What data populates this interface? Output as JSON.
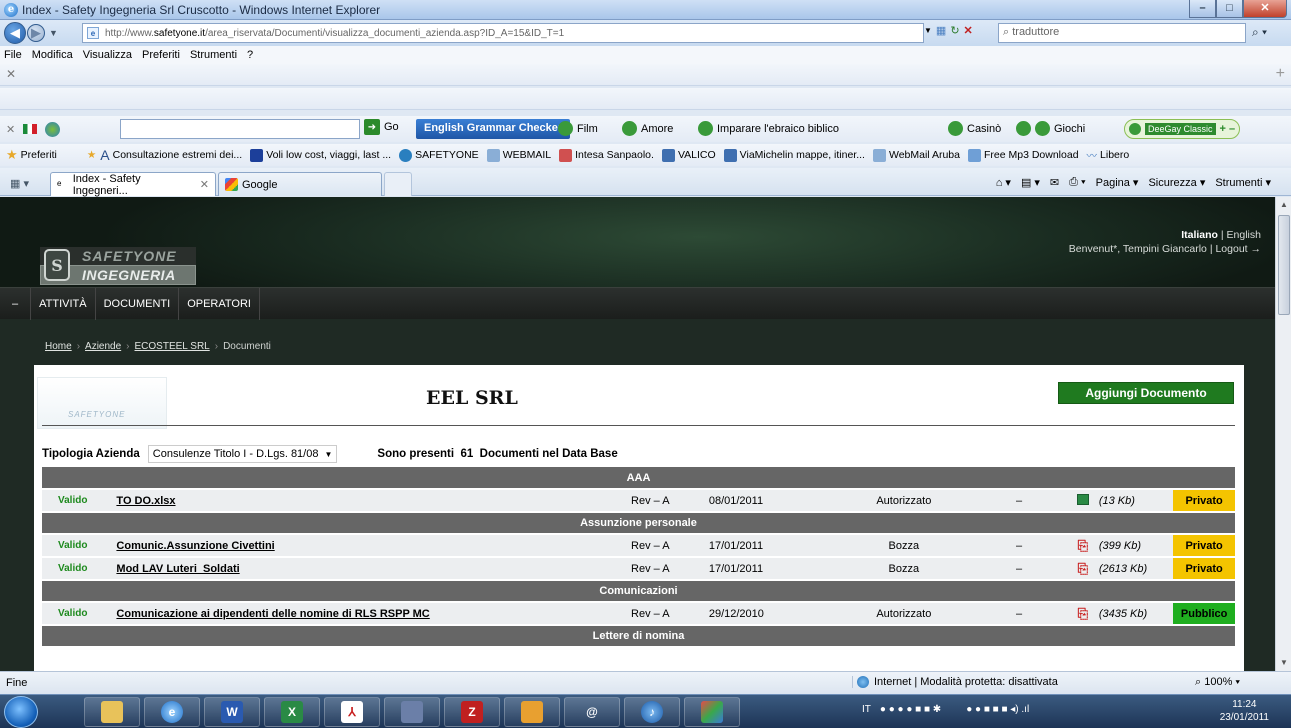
{
  "window": {
    "title": "Index - Safety Ingegneria Srl Cruscotto - Windows Internet Explorer",
    "min": "–",
    "max": "□",
    "close": "✕"
  },
  "address": {
    "url_prefix": "http://www.",
    "url_domain": "safetyone.it",
    "url_rest": "/area_riservata/Documenti/visualizza_documenti_azienda.asp?ID_A=15&ID_T=1",
    "search_placeholder": "traduttore"
  },
  "menu": [
    "File",
    "Modifica",
    "Visualizza",
    "Preferiti",
    "Strumenti",
    "?"
  ],
  "toolbar": {
    "go": "Go",
    "grammar": "English Grammar Checker",
    "film": "Film",
    "amore": "Amore",
    "ebraico": "Imparare l'ebraico biblico",
    "casino": "Casinò",
    "giochi": "Giochi",
    "deegay": "DeeGay Classic"
  },
  "favorites": {
    "label": "Preferiti",
    "items": [
      "Consultazione estremi dei...",
      "Voli low cost, viaggi, last ...",
      "SAFETYONE",
      "WEBMAIL",
      "Intesa Sanpaolo.",
      "VALICO",
      "ViaMichelin mappe, itiner...",
      "WebMail Aruba",
      "Free Mp3 Download",
      "Libero"
    ]
  },
  "tabs": [
    {
      "label": "Index - Safety Ingegneri...",
      "close": "✕"
    },
    {
      "label": "Google"
    }
  ],
  "commands": [
    "Pagina ▾",
    "Sicurezza ▾",
    "Strumenti ▾"
  ],
  "site": {
    "logo_top": "SAFETYONE",
    "logo_bottom": "INGEGNERIA",
    "lang_active": "Italiano",
    "lang_sep": " | ",
    "lang_other": "English",
    "welcome": "Benvenut*, Tempini Giancarlo | Logout →",
    "nav": [
      "–",
      "ATTIVITÀ",
      "DOCUMENTI",
      "OPERATORI"
    ],
    "breadcrumbs": [
      "Home",
      "Aziende",
      "ECOSTEEL SRL",
      "Documenti"
    ]
  },
  "content": {
    "company_logo_text": "SAFETYONE",
    "company": "EEL SRL",
    "add_button": "Aggiungi Documento",
    "type_label": "Tipologia Azienda",
    "type_value": "Consulenze Titolo I - D.Lgs. 81/08",
    "count_prefix": "Sono presenti",
    "count": "61",
    "count_suffix": "Documenti nel Data Base",
    "groups": [
      {
        "name": "AAA",
        "docs": [
          {
            "status": "Valido",
            "name": "TO DO.xlsx",
            "rev": "Rev – A",
            "date": "08/01/2011",
            "state": "Autorizzato",
            "dash": "–",
            "icon": "excel-icon",
            "size": "(13 Kb)",
            "visibility": "Privato"
          }
        ]
      },
      {
        "name": "Assunzione personale",
        "docs": [
          {
            "status": "Valido",
            "name": "Comunic.Assunzione Civettini",
            "rev": "Rev – A",
            "date": "17/01/2011",
            "state": "Bozza",
            "dash": "–",
            "icon": "pdf-icon",
            "size": "(399 Kb)",
            "visibility": "Privato"
          },
          {
            "status": "Valido",
            "name": "Mod LAV Luteri_Soldati",
            "rev": "Rev – A",
            "date": "17/01/2011",
            "state": "Bozza",
            "dash": "–",
            "icon": "pdf-icon",
            "size": "(2613 Kb)",
            "visibility": "Privato"
          }
        ]
      },
      {
        "name": "Comunicazioni",
        "docs": [
          {
            "status": "Valido",
            "name": "Comunicazione ai dipendenti delle nomine di RLS RSPP MC",
            "rev": "Rev – A",
            "date": "29/12/2010",
            "state": "Autorizzato",
            "dash": "–",
            "icon": "pdf-icon",
            "size": "(3435 Kb)",
            "visibility": "Pubblico"
          }
        ]
      },
      {
        "name": "Lettere di nomina",
        "docs": []
      }
    ]
  },
  "status": {
    "left": "Fine",
    "zone": "Internet | Modalità protetta: disattivata",
    "zoom": "100%"
  },
  "taskbar": {
    "lang": "IT",
    "time": "11:24",
    "date": "23/01/2011"
  },
  "colors": {
    "valid": "#1e8a1e",
    "private": "#f4c400",
    "public": "#1fae1f",
    "add_button": "#1f7a1f"
  }
}
